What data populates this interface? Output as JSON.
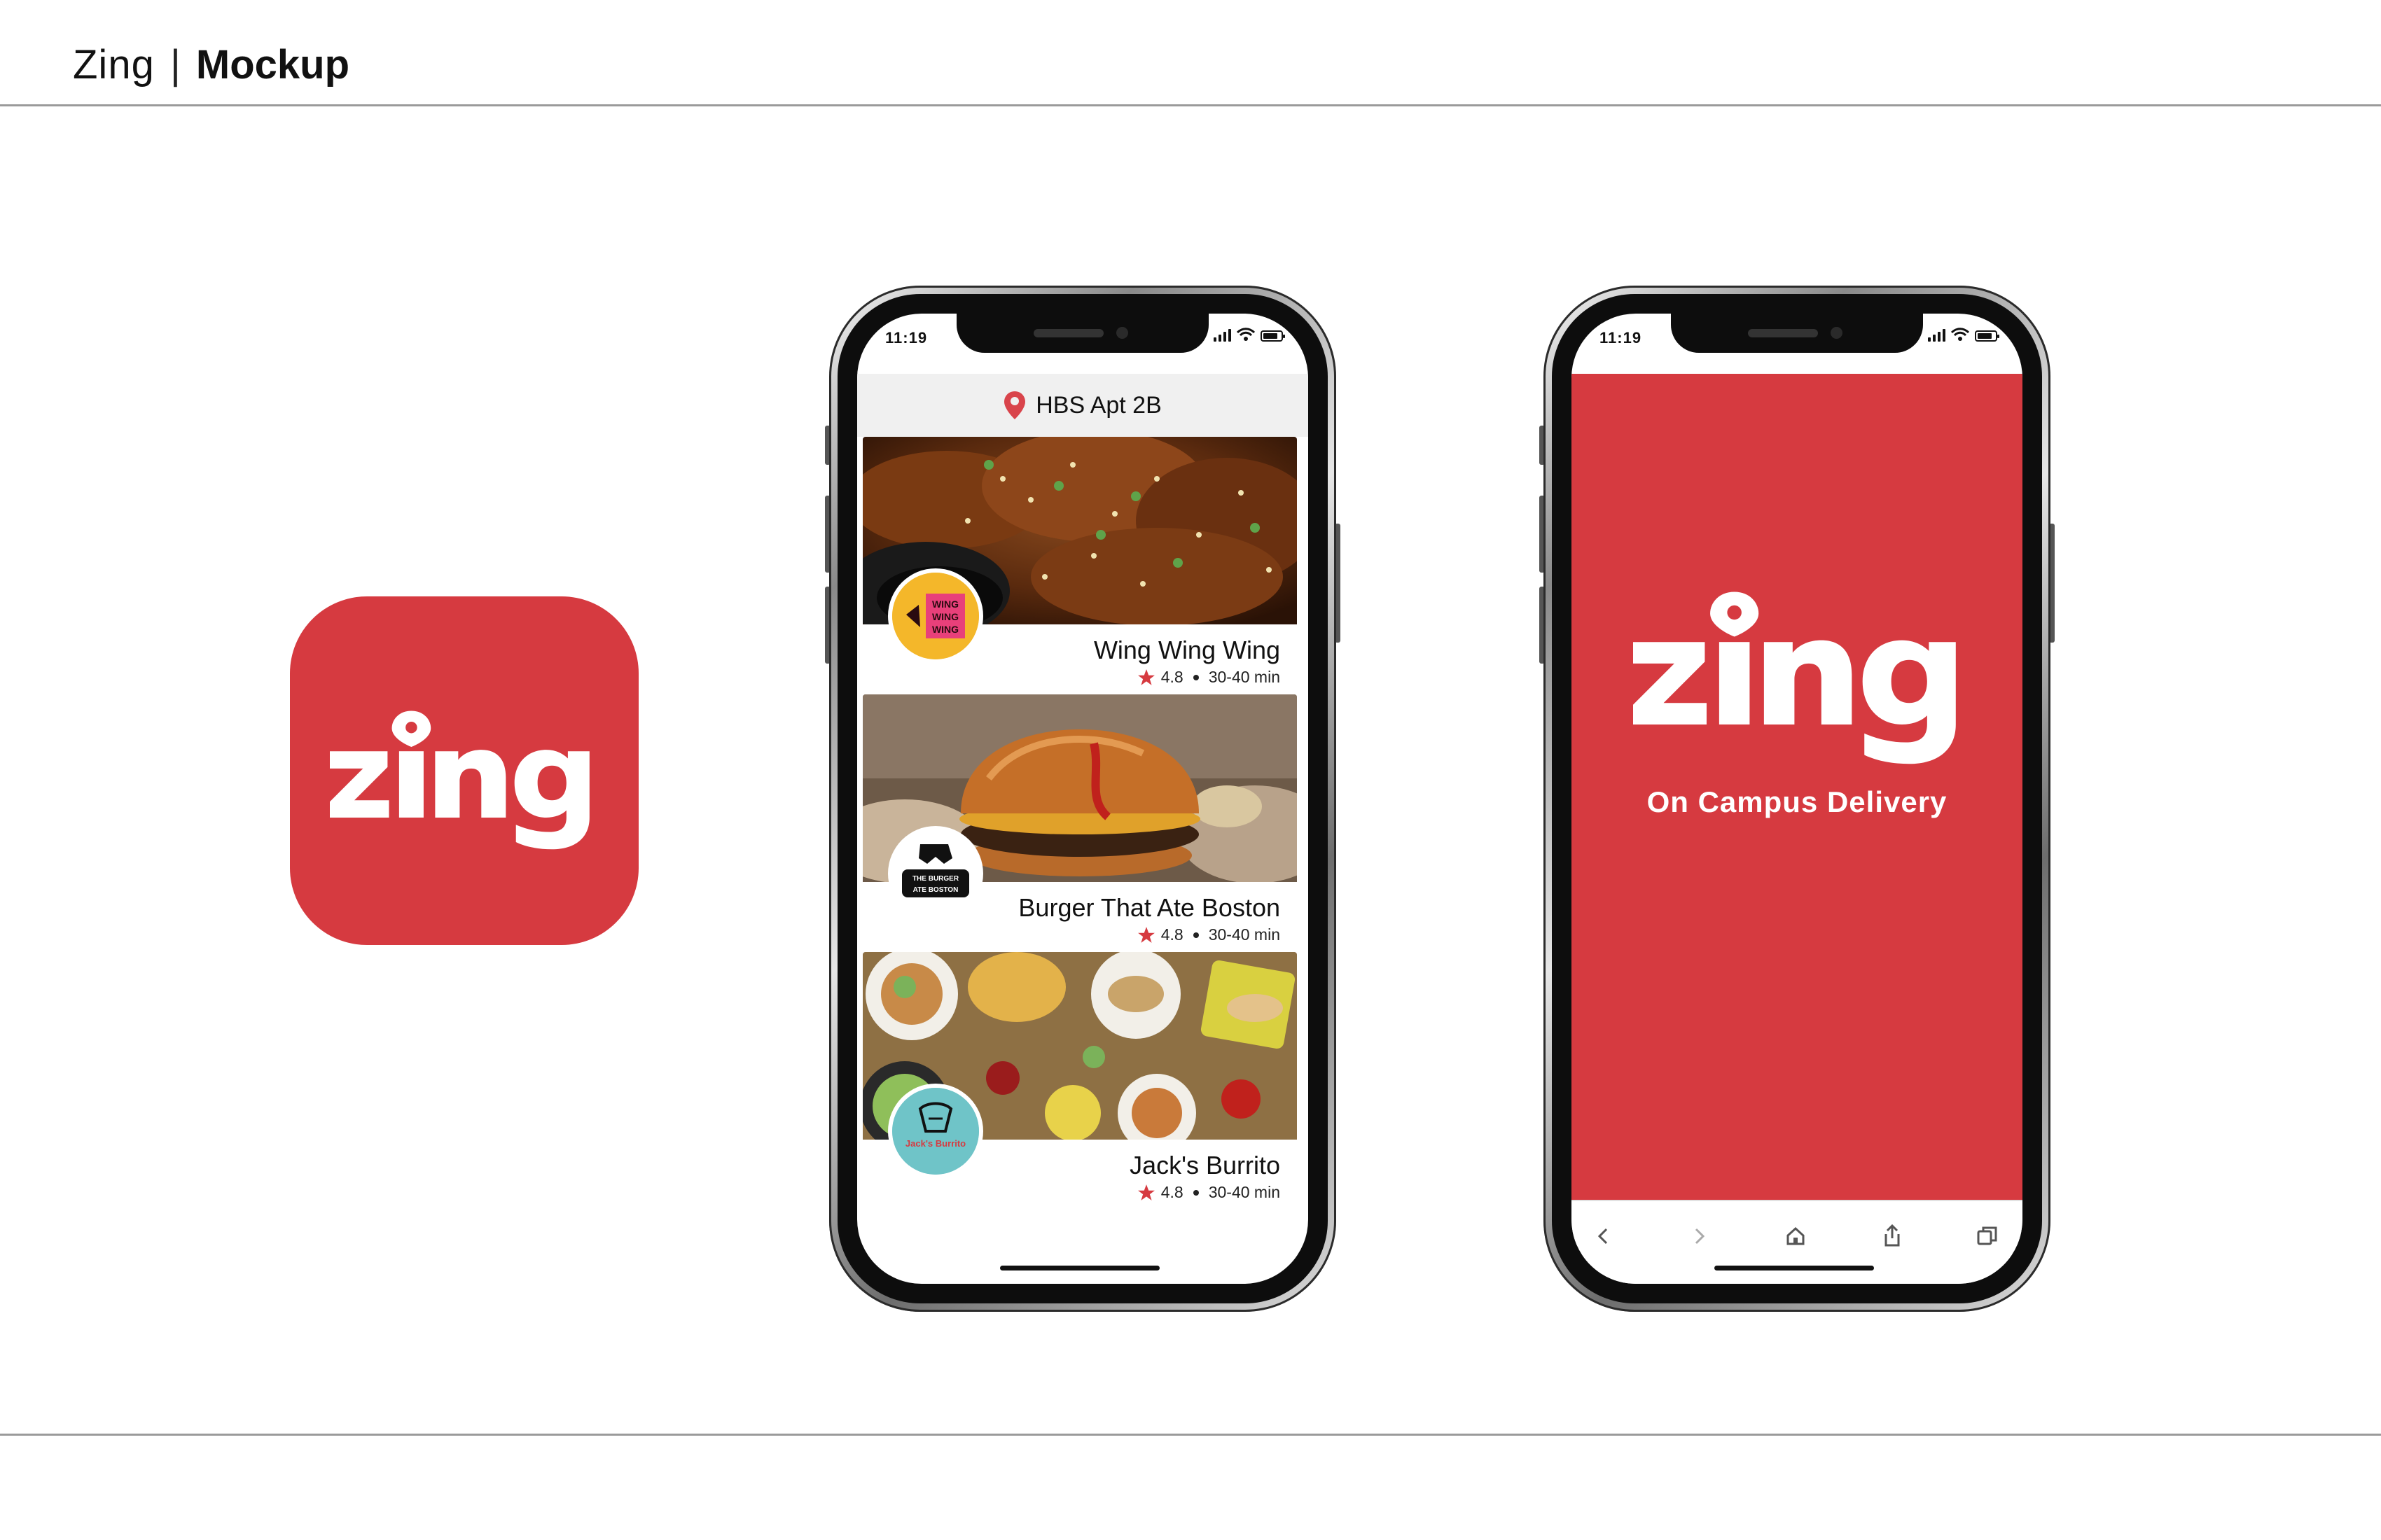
{
  "header": {
    "brand": "Zing",
    "separator": "|",
    "section": "Mockup"
  },
  "colors": {
    "brand_red": "#d63a40",
    "rating_star": "#d63a40",
    "location_pin": "#d9444b"
  },
  "phone_list": {
    "status_time": "11:19",
    "location": {
      "label": "HBS Apt 2B",
      "icon": "location-pin-icon"
    },
    "restaurants": [
      {
        "name": "Wing Wing Wing",
        "rating": "4.8",
        "delivery_time": "30-40 min",
        "logo_text": "WING WING WING"
      },
      {
        "name": "Burger That Ate Boston",
        "rating": "4.8",
        "delivery_time": "30-40 min",
        "logo_text": "THE BURGER THAT ATE BOSTON"
      },
      {
        "name": "Jack's Burrito",
        "rating": "4.8",
        "delivery_time": "30-40 min",
        "logo_text": "Jack's Burrito"
      }
    ]
  },
  "phone_splash": {
    "status_time": "11:19",
    "brand": "zing",
    "tagline": "On Campus Delivery",
    "browser_icons": [
      "back-icon",
      "forward-icon",
      "home-icon",
      "share-icon",
      "tabs-icon"
    ]
  },
  "app_icon": {
    "brand": "zing"
  }
}
